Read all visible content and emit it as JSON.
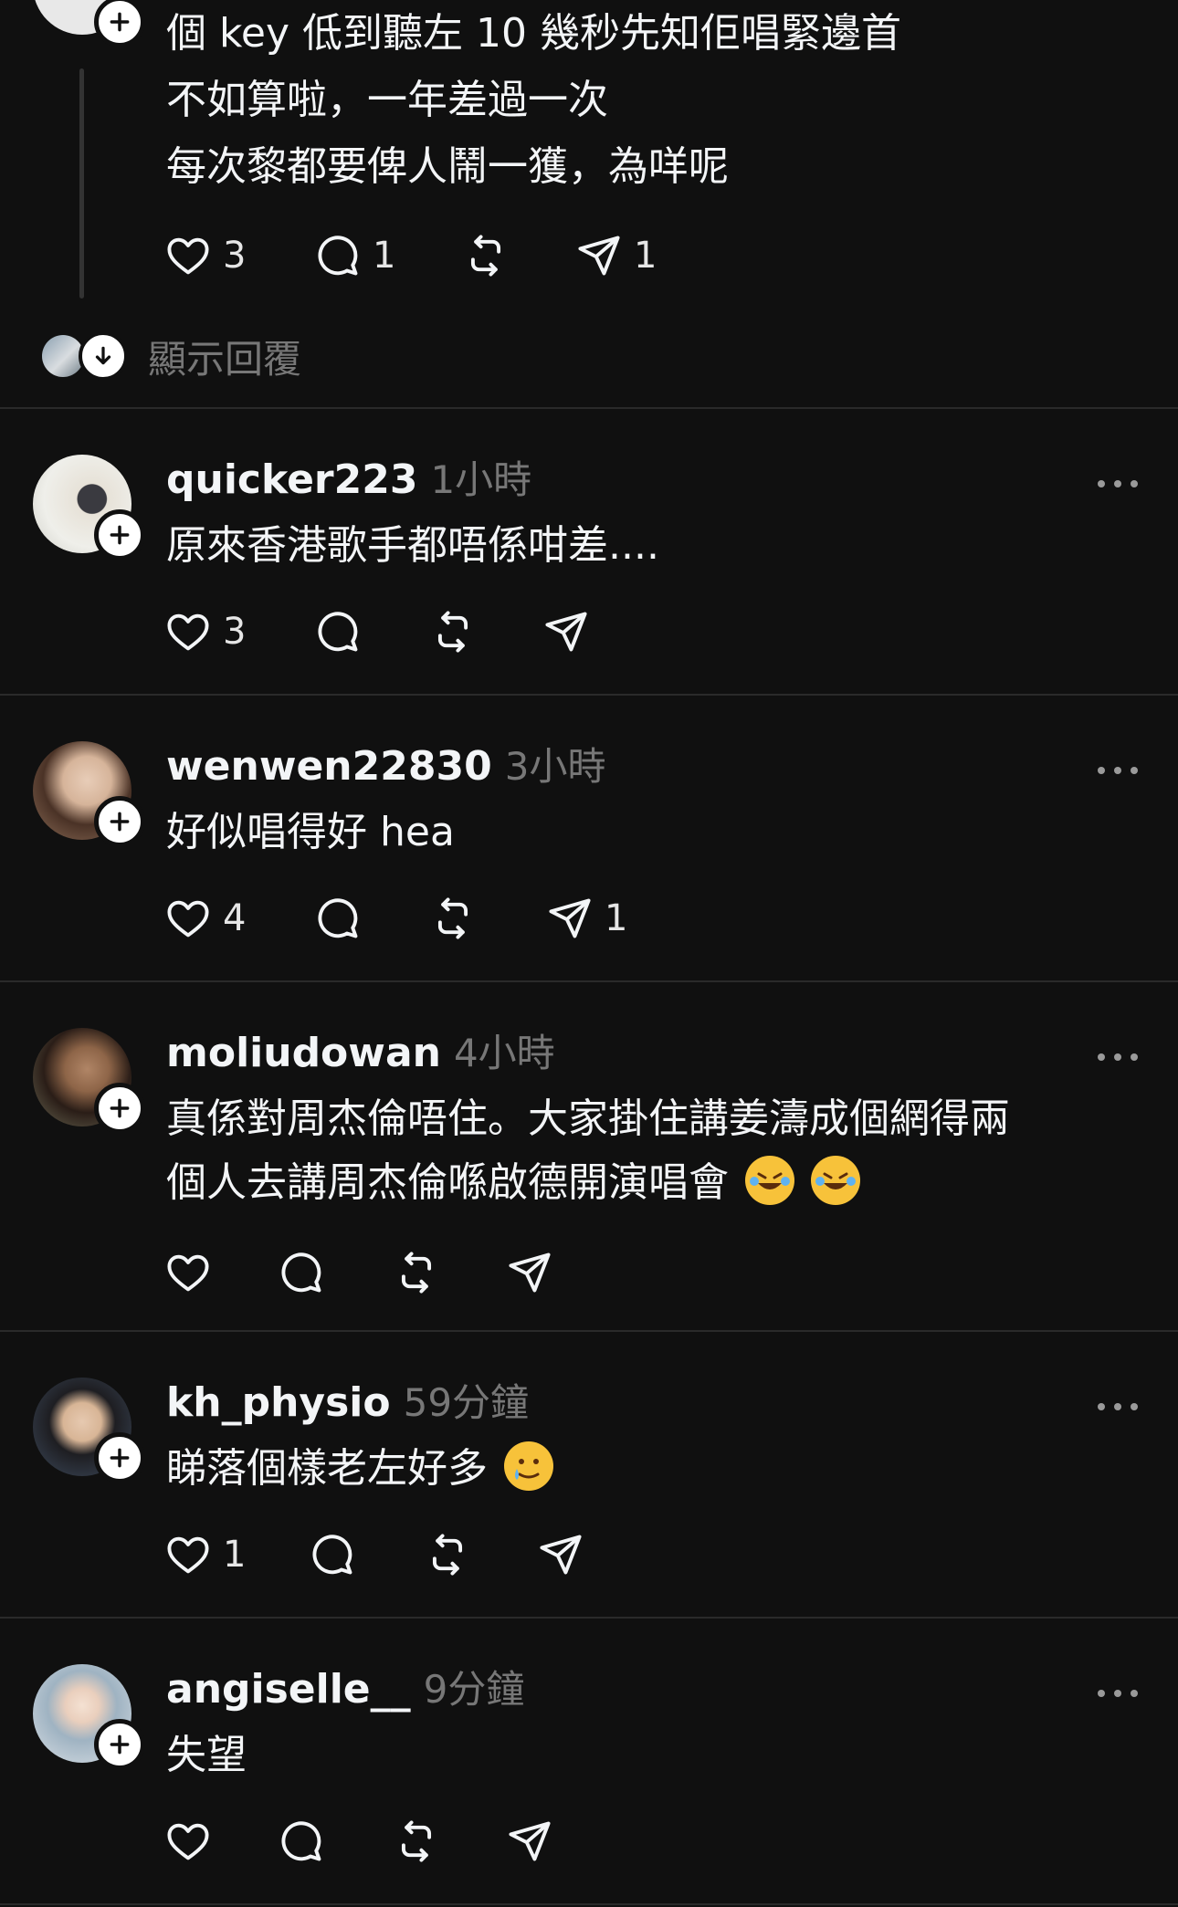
{
  "top_post": {
    "lines": [
      "個 key 低到聽左 10 幾秒先知佢唱緊邊首",
      "不如算啦，一年差過一次",
      "每次黎都要俾人鬧一獲，為咩呢"
    ],
    "likes": "3",
    "replies": "1",
    "shares": "1",
    "show_replies_label": "顯示回覆"
  },
  "comments": [
    {
      "username": "quicker223",
      "time": "1小時",
      "text": "原來香港歌手都唔係咁差....",
      "likes": "3",
      "replies": "",
      "shares": ""
    },
    {
      "username": "wenwen22830",
      "time": "3小時",
      "text": "好似唱得好 hea",
      "likes": "4",
      "replies": "",
      "shares": "1"
    },
    {
      "username": "moliudowan",
      "time": "4小時",
      "text_line1": "真係對周杰倫唔住。大家掛住講姜濤成個網得兩",
      "text_line2": "個人去講周杰倫喺啟德開演唱會",
      "likes": "",
      "replies": "",
      "shares": ""
    },
    {
      "username": "kh_physio",
      "time": "59分鐘",
      "text": "睇落個樣老左好多",
      "likes": "1",
      "replies": "",
      "shares": ""
    },
    {
      "username": "angiselle__",
      "time": "9分鐘",
      "text": "失望",
      "likes": "",
      "replies": "",
      "shares": ""
    }
  ],
  "icons": {
    "like": "heart-icon",
    "reply": "comment-icon",
    "repost": "repost-icon",
    "share": "send-icon",
    "more": "more-icon",
    "follow": "plus-icon",
    "laugh_emoji": "rolling-on-floor-laughing-emoji",
    "tear_smile_emoji": "smiling-face-with-tear-emoji"
  },
  "colors": {
    "background": "#101010",
    "text": "#f3f5f7",
    "muted": "#777777",
    "divider": "#2a2a2a"
  }
}
